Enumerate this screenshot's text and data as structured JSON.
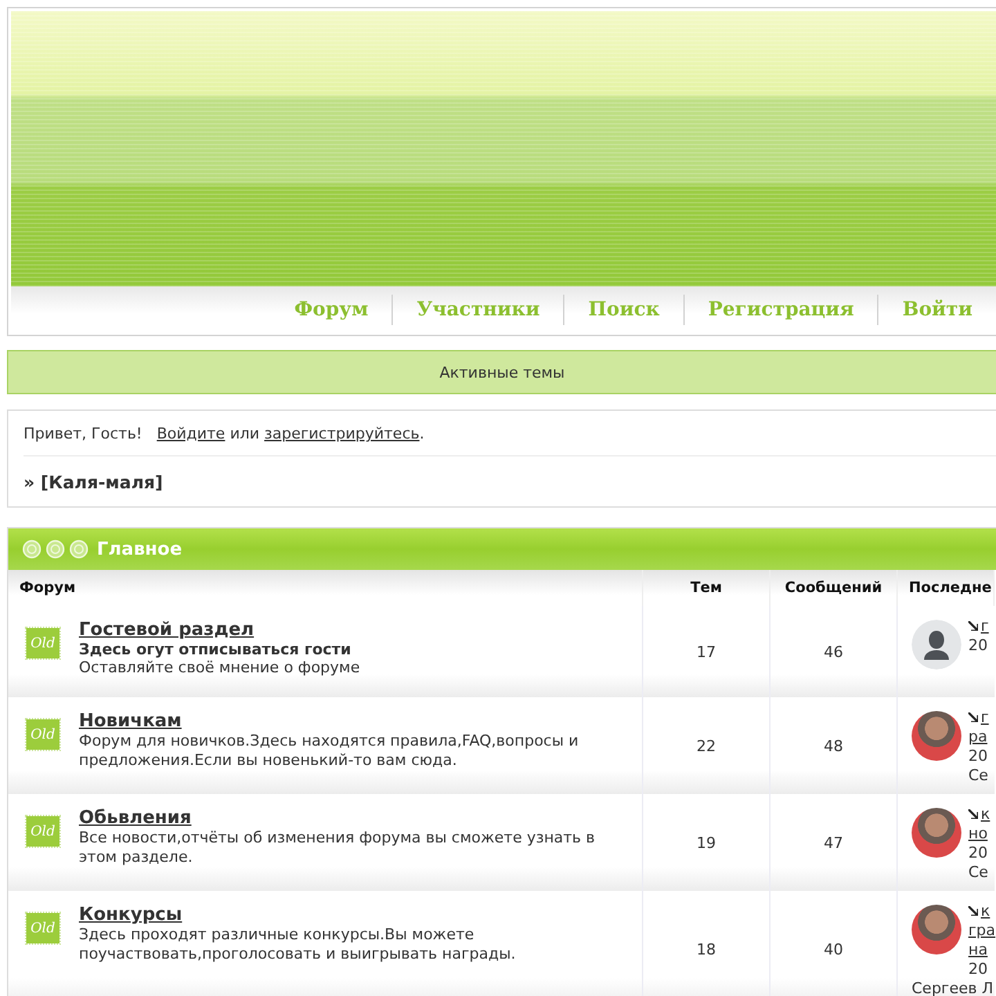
{
  "header": {
    "nav": [
      {
        "label": "Форум"
      },
      {
        "label": "Участники"
      },
      {
        "label": "Поиск"
      },
      {
        "label": "Регистрация"
      },
      {
        "label": "Войти"
      }
    ]
  },
  "active_topics": "Активные темы",
  "welcome": {
    "greeting": "Привет, Гость!",
    "login_link": "Войдите",
    "or": "или",
    "register_link": "зарегистрируйтесь",
    "end": "."
  },
  "breadcrumb": "» [Каля-маля]",
  "category": {
    "title": "Главное",
    "columns": [
      "Форум",
      "Тем",
      "Сообщений",
      "Последне"
    ],
    "forums": [
      {
        "title": "Гостевой раздел",
        "subtitle": "Здесь огут отписываться гости",
        "description": "Оставляйте своё мнение о форуме",
        "icon_label": "Old",
        "topics": "17",
        "posts": "46",
        "last_post": {
          "kind": "guest",
          "lines": [
            {
              "text": "г",
              "link": true
            },
            {
              "text": "20",
              "link": false
            }
          ]
        }
      },
      {
        "title": "Новичкам",
        "description": "Форум для новичков.Здесь находятся правила,FAQ,вопросы и предложения.Если вы новенький-то вам сюда.",
        "icon_label": "Old",
        "topics": "22",
        "posts": "48",
        "last_post": {
          "kind": "photo",
          "lines": [
            {
              "text": "г",
              "link": true
            },
            {
              "text": "ра",
              "link": true
            },
            {
              "text": "20",
              "link": false
            },
            {
              "text": "Се",
              "link": false
            }
          ]
        }
      },
      {
        "title": "Обьвления",
        "description": "Все новости,отчёты об изменения форума вы сможете узнать в этом разделе.",
        "icon_label": "Old",
        "topics": "19",
        "posts": "47",
        "last_post": {
          "kind": "photo",
          "lines": [
            {
              "text": "к",
              "link": true
            },
            {
              "text": "но",
              "link": true
            },
            {
              "text": "20",
              "link": false
            },
            {
              "text": "Се",
              "link": false
            }
          ]
        }
      },
      {
        "title": "Конкурсы",
        "description": "Здесь проходят различные конкурсы.Вы можете поучаствовать,проголосовать и выигрывать награды.",
        "icon_label": "Old",
        "topics": "18",
        "posts": "40",
        "last_post": {
          "kind": "photo",
          "lines": [
            {
              "text": "к",
              "link": true
            },
            {
              "text": "гра",
              "link": true
            },
            {
              "text": "на",
              "link": true
            },
            {
              "text": "20",
              "link": false
            },
            {
              "text": "Сергеев Л",
              "link": false
            }
          ]
        }
      }
    ]
  }
}
